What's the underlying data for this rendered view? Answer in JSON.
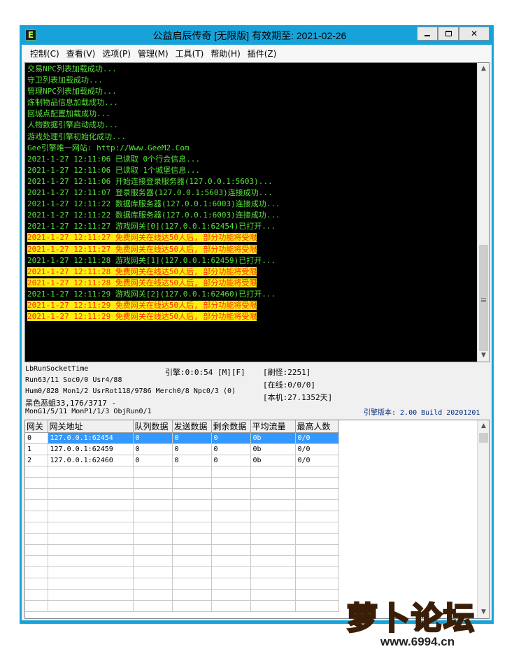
{
  "window": {
    "title": "公益启辰传奇 [无限版] 有效期至: 2021-02-26",
    "icon_letter": "E",
    "minimize_icon": "minimize-icon",
    "maximize_icon": "maximize-icon",
    "close_label": "✕"
  },
  "menu": [
    "控制(C)",
    "查看(V)",
    "选项(P)",
    "管理(M)",
    "工具(T)",
    "帮助(H)",
    "插件(Z)"
  ],
  "log": [
    {
      "text": "交易NPC列表加载成功...",
      "warn": false
    },
    {
      "text": "守卫列表加载成功...",
      "warn": false
    },
    {
      "text": "管理NPC列表加载成功...",
      "warn": false
    },
    {
      "text": "炼制物品信息加载成功...",
      "warn": false
    },
    {
      "text": "回城点配置加载成功...",
      "warn": false
    },
    {
      "text": "人物数据引擎启动成功...",
      "warn": false
    },
    {
      "text": "游戏处理引擎初始化成功...",
      "warn": false
    },
    {
      "text": "Gee引擎唯一网站: http://Www.GeeM2.Com",
      "warn": false
    },
    {
      "text": "2021-1-27 12:11:06 已读取 0个行会信息...",
      "warn": false
    },
    {
      "text": "2021-1-27 12:11:06 已读取 1个城堡信息...",
      "warn": false
    },
    {
      "text": "2021-1-27 12:11:06 开始连接登录服务器(127.0.0.1:5603)...",
      "warn": false
    },
    {
      "text": "2021-1-27 12:11:07 登录服务器(127.0.0.1:5603)连接成功...",
      "warn": false
    },
    {
      "text": "2021-1-27 12:11:22 数据库服务器(127.0.0.1:6003)连接成功...",
      "warn": false
    },
    {
      "text": "2021-1-27 12:11:22 数据库服务器(127.0.0.1:6003)连接成功...",
      "warn": false
    },
    {
      "text": "2021-1-27 12:11:27 游戏网关[0](127.0.0.1:62454)已打开...",
      "warn": false
    },
    {
      "text": "2021-1-27 12:11:27 免费网关在线达50人后, 部分功能将受限",
      "warn": true
    },
    {
      "text": "2021-1-27 12:11:27 免费网关在线达50人后, 部分功能将受限",
      "warn": true
    },
    {
      "text": "2021-1-27 12:11:28 游戏网关[1](127.0.0.1:62459)已打开...",
      "warn": false
    },
    {
      "text": "2021-1-27 12:11:28 免费网关在线达50人后, 部分功能将受限",
      "warn": true
    },
    {
      "text": "2021-1-27 12:11:28 免费网关在线达50人后, 部分功能将受限",
      "warn": true
    },
    {
      "text": "2021-1-27 12:11:29 游戏网关[2](127.0.0.1:62460)已打开...",
      "warn": false
    },
    {
      "text": "2021-1-27 12:11:29 免费网关在线达50人后, 部分功能将受限",
      "warn": true
    },
    {
      "text": "2021-1-27 12:11:29 免费网关在线达50人后, 部分功能将受限",
      "warn": true
    }
  ],
  "status": {
    "socket": "LbRunSocketTime",
    "engine": "引擎:0:0:54 [M][F]",
    "refresh": "[刷怪:2251]",
    "run": "Run63/11 Soc0/0 Usr4/88",
    "online": "[在线:0/0/0]",
    "hum": "Hum0/828 Mon1/2 UsrRot118/9786 Merch0/8 Npc0/3 (0)",
    "local": "[本机:27.1352天]",
    "monster": "黑色恶蛆33,176/3717 -",
    "mong": "MonG1/5/11 MonP1/1/3 ObjRun0/1",
    "version": "引擎版本: 2.00 Build 20201201"
  },
  "grid": {
    "headers": [
      "网关",
      "网关地址",
      "队列数据",
      "发送数据",
      "剩余数据",
      "平均流量",
      "最高人数"
    ],
    "rows": [
      [
        "0",
        "127.0.0.1:62454",
        "0",
        "0",
        "0",
        "0b",
        "0/0"
      ],
      [
        "1",
        "127.0.0.1:62459",
        "0",
        "0",
        "0",
        "0b",
        "0/0"
      ],
      [
        "2",
        "127.0.0.1:62460",
        "0",
        "0",
        "0",
        "0b",
        "0/0"
      ]
    ],
    "selected_row": 0,
    "empty_rows": 13
  },
  "watermark": {
    "text": "萝卜论坛",
    "url": "www.6994.cn"
  },
  "colors": {
    "frame": "#17a3d9",
    "log_text": "#58e13a",
    "warn_bg": "#ffec13",
    "warn_text": "#ff2a00",
    "selection": "#3399ff"
  }
}
